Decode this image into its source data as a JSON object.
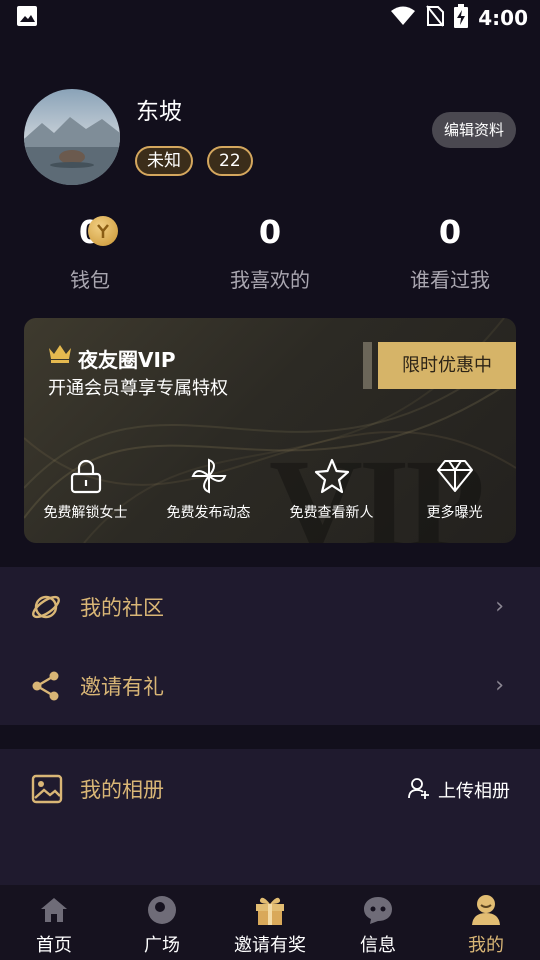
{
  "status_bar": {
    "time": "4:00"
  },
  "profile": {
    "username": "东坡",
    "gender_tag": "未知",
    "age_tag": "22",
    "edit_button": "编辑资料"
  },
  "stats": [
    {
      "value": "0",
      "label": "钱包"
    },
    {
      "value": "0",
      "label": "我喜欢的"
    },
    {
      "value": "0",
      "label": "谁看过我"
    }
  ],
  "vip": {
    "title": "夜友圈VIP",
    "subtitle": "开通会员尊享专属特权",
    "promo": "限时优惠中",
    "watermark": "VIP",
    "features": [
      {
        "icon": "lock-icon",
        "label": "免费解锁女士"
      },
      {
        "icon": "pinwheel-icon",
        "label": "免费发布动态"
      },
      {
        "icon": "star-icon",
        "label": "免费查看新人"
      },
      {
        "icon": "diamond-icon",
        "label": "更多曝光"
      }
    ]
  },
  "menu": [
    {
      "icon": "planet-icon",
      "label": "我的社区"
    },
    {
      "icon": "share-icon",
      "label": "邀请有礼"
    }
  ],
  "album": {
    "title": "我的相册",
    "upload": "上传相册"
  },
  "tabs": [
    {
      "icon": "home-icon",
      "label": "首页",
      "active": false
    },
    {
      "icon": "ball-icon",
      "label": "广场",
      "active": false
    },
    {
      "icon": "gift-icon",
      "label": "邀请有奖",
      "active": false
    },
    {
      "icon": "chat-icon",
      "label": "信息",
      "active": false
    },
    {
      "icon": "user-icon",
      "label": "我的",
      "active": true
    }
  ],
  "colors": {
    "accent": "#d9b676",
    "background": "#120f1c",
    "panel": "#1f1a2e"
  }
}
